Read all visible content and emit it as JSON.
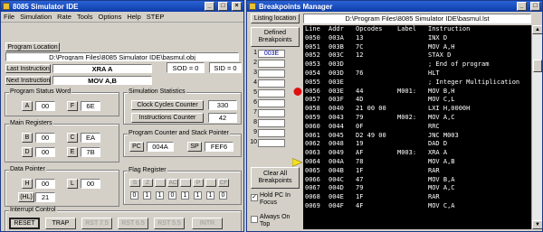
{
  "sim": {
    "title": "8085 Simulator IDE",
    "menu": [
      "File",
      "Simulation",
      "Rate",
      "Tools",
      "Options",
      "Help",
      "STEP"
    ],
    "program_location_label": "Program Location",
    "program_path": "D:\\Program Files\\8085 Simulator IDE\\basmul.obj",
    "last_instruction_label": "Last Instruction",
    "last_instruction": "XRA A",
    "sod": "SOD = 0",
    "sid": "SID = 0",
    "next_instruction_label": "Next Instruction",
    "next_instruction": "MOV A,B",
    "psw": {
      "title": "Program Status Word",
      "a_label": "A",
      "a_value": "00",
      "f_label": "F",
      "f_value": "6E"
    },
    "stats": {
      "title": "Simulation Statistics",
      "clock_label": "Clock Cycles Counter",
      "clock_value": "330",
      "instr_label": "Instructions Counter",
      "instr_value": "42"
    },
    "regs": {
      "title": "Main Registers",
      "b_label": "B",
      "b_value": "00",
      "c_label": "C",
      "c_value": "EA",
      "d_label": "D",
      "d_value": "00",
      "e_label": "E",
      "e_value": "7B"
    },
    "pcsp": {
      "title": "Program Counter and Stack Pointer",
      "pc_label": "PC",
      "pc_value": "004A",
      "sp_label": "SP",
      "sp_value": "FEF6"
    },
    "dp": {
      "title": "Data Pointer",
      "h_label": "H",
      "h_value": "00",
      "l_label": "L",
      "l_value": "00",
      "hl_label": "(HL)",
      "hl_value": "21"
    },
    "flags": {
      "title": "Flag Register",
      "names": [
        "S",
        "Z",
        "",
        "AC",
        "",
        "P",
        "",
        "CF"
      ],
      "bits": [
        "0",
        "1",
        "1",
        "0",
        "1",
        "1",
        "1",
        "0"
      ]
    },
    "interrupt": {
      "title": "Interrupt Control",
      "buttons": [
        "RESET",
        "TRAP",
        "RST 7.5",
        "RST 6.5",
        "RST 5.5",
        "INTR"
      ]
    }
  },
  "bp": {
    "title": "Breakpoints Manager",
    "listing_button": "Listing location",
    "listing_path": "D:\\Program Files\\8085 Simulator IDE\\basmul.lst",
    "defined_label": "Defined Breakpoints",
    "breakpoints": [
      "003E",
      "",
      "",
      "",
      "",
      "",
      "",
      "",
      "",
      ""
    ],
    "clear_all": "Clear All Breakpoints",
    "hold_pc": "Hold PC In Focus",
    "always_on_top": "Always On Top",
    "columns": [
      "Line",
      "Addr",
      "Opcodes",
      "Label",
      "Instruction"
    ],
    "rows": [
      {
        "line": "0050",
        "addr": "003A",
        "op": "13",
        "label": "",
        "ins": "INX D"
      },
      {
        "line": "0051",
        "addr": "003B",
        "op": "7C",
        "label": "",
        "ins": "MOV A,H"
      },
      {
        "line": "0052",
        "addr": "003C",
        "op": "12",
        "label": "",
        "ins": "STAX D"
      },
      {
        "line": "0053",
        "addr": "003D",
        "op": "",
        "label": "",
        "ins": "; End of program"
      },
      {
        "line": "0054",
        "addr": "003D",
        "op": "76",
        "label": "",
        "ins": "HLT"
      },
      {
        "line": "0055",
        "addr": "003E",
        "op": "",
        "label": "",
        "ins": "; Integer Multiplication"
      },
      {
        "line": "0056",
        "addr": "003E",
        "op": "44",
        "label": "M001:",
        "ins": "MOV B,H"
      },
      {
        "line": "0057",
        "addr": "003F",
        "op": "4D",
        "label": "",
        "ins": "MOV C,L"
      },
      {
        "line": "0058",
        "addr": "0040",
        "op": "21 00 00",
        "label": "",
        "ins": "LXI H,0000H"
      },
      {
        "line": "0059",
        "addr": "0043",
        "op": "79",
        "label": "M002:",
        "ins": "MOV A,C"
      },
      {
        "line": "0060",
        "addr": "0044",
        "op": "0F",
        "label": "",
        "ins": "RRC"
      },
      {
        "line": "0061",
        "addr": "0045",
        "op": "D2 49 00",
        "label": "",
        "ins": "JNC M003"
      },
      {
        "line": "0062",
        "addr": "0048",
        "op": "19",
        "label": "",
        "ins": "DAD D"
      },
      {
        "line": "0063",
        "addr": "0049",
        "op": "AF",
        "label": "M003:",
        "ins": "XRA A"
      },
      {
        "line": "0064",
        "addr": "004A",
        "op": "78",
        "label": "",
        "ins": "MOV A,B"
      },
      {
        "line": "0065",
        "addr": "004B",
        "op": "1F",
        "label": "",
        "ins": "RAR"
      },
      {
        "line": "0066",
        "addr": "004C",
        "op": "47",
        "label": "",
        "ins": "MOV B,A"
      },
      {
        "line": "0067",
        "addr": "004D",
        "op": "79",
        "label": "",
        "ins": "MOV A,C"
      },
      {
        "line": "0068",
        "addr": "004E",
        "op": "1F",
        "label": "",
        "ins": "RAR"
      },
      {
        "line": "0069",
        "addr": "004F",
        "op": "4F",
        "label": "",
        "ins": "MOV C,A"
      }
    ],
    "breakpoint_row": 6,
    "current_row": 14,
    "colors": {
      "breakpoint_dot": "#e01010",
      "current_arrow": "#f0e020"
    }
  }
}
